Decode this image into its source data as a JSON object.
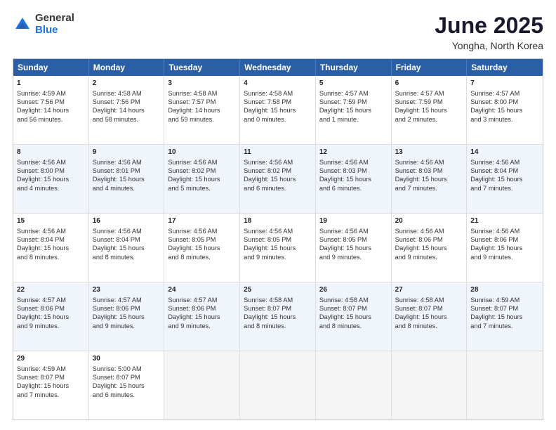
{
  "logo": {
    "general": "General",
    "blue": "Blue"
  },
  "title": "June 2025",
  "subtitle": "Yongha, North Korea",
  "header_days": [
    "Sunday",
    "Monday",
    "Tuesday",
    "Wednesday",
    "Thursday",
    "Friday",
    "Saturday"
  ],
  "weeks": [
    {
      "alt": false,
      "cells": [
        {
          "day": "1",
          "lines": [
            "Sunrise: 4:59 AM",
            "Sunset: 7:56 PM",
            "Daylight: 14 hours",
            "and 56 minutes."
          ]
        },
        {
          "day": "2",
          "lines": [
            "Sunrise: 4:58 AM",
            "Sunset: 7:56 PM",
            "Daylight: 14 hours",
            "and 58 minutes."
          ]
        },
        {
          "day": "3",
          "lines": [
            "Sunrise: 4:58 AM",
            "Sunset: 7:57 PM",
            "Daylight: 14 hours",
            "and 59 minutes."
          ]
        },
        {
          "day": "4",
          "lines": [
            "Sunrise: 4:58 AM",
            "Sunset: 7:58 PM",
            "Daylight: 15 hours",
            "and 0 minutes."
          ]
        },
        {
          "day": "5",
          "lines": [
            "Sunrise: 4:57 AM",
            "Sunset: 7:59 PM",
            "Daylight: 15 hours",
            "and 1 minute."
          ]
        },
        {
          "day": "6",
          "lines": [
            "Sunrise: 4:57 AM",
            "Sunset: 7:59 PM",
            "Daylight: 15 hours",
            "and 2 minutes."
          ]
        },
        {
          "day": "7",
          "lines": [
            "Sunrise: 4:57 AM",
            "Sunset: 8:00 PM",
            "Daylight: 15 hours",
            "and 3 minutes."
          ]
        }
      ]
    },
    {
      "alt": true,
      "cells": [
        {
          "day": "8",
          "lines": [
            "Sunrise: 4:56 AM",
            "Sunset: 8:00 PM",
            "Daylight: 15 hours",
            "and 4 minutes."
          ]
        },
        {
          "day": "9",
          "lines": [
            "Sunrise: 4:56 AM",
            "Sunset: 8:01 PM",
            "Daylight: 15 hours",
            "and 4 minutes."
          ]
        },
        {
          "day": "10",
          "lines": [
            "Sunrise: 4:56 AM",
            "Sunset: 8:02 PM",
            "Daylight: 15 hours",
            "and 5 minutes."
          ]
        },
        {
          "day": "11",
          "lines": [
            "Sunrise: 4:56 AM",
            "Sunset: 8:02 PM",
            "Daylight: 15 hours",
            "and 6 minutes."
          ]
        },
        {
          "day": "12",
          "lines": [
            "Sunrise: 4:56 AM",
            "Sunset: 8:03 PM",
            "Daylight: 15 hours",
            "and 6 minutes."
          ]
        },
        {
          "day": "13",
          "lines": [
            "Sunrise: 4:56 AM",
            "Sunset: 8:03 PM",
            "Daylight: 15 hours",
            "and 7 minutes."
          ]
        },
        {
          "day": "14",
          "lines": [
            "Sunrise: 4:56 AM",
            "Sunset: 8:04 PM",
            "Daylight: 15 hours",
            "and 7 minutes."
          ]
        }
      ]
    },
    {
      "alt": false,
      "cells": [
        {
          "day": "15",
          "lines": [
            "Sunrise: 4:56 AM",
            "Sunset: 8:04 PM",
            "Daylight: 15 hours",
            "and 8 minutes."
          ]
        },
        {
          "day": "16",
          "lines": [
            "Sunrise: 4:56 AM",
            "Sunset: 8:04 PM",
            "Daylight: 15 hours",
            "and 8 minutes."
          ]
        },
        {
          "day": "17",
          "lines": [
            "Sunrise: 4:56 AM",
            "Sunset: 8:05 PM",
            "Daylight: 15 hours",
            "and 8 minutes."
          ]
        },
        {
          "day": "18",
          "lines": [
            "Sunrise: 4:56 AM",
            "Sunset: 8:05 PM",
            "Daylight: 15 hours",
            "and 9 minutes."
          ]
        },
        {
          "day": "19",
          "lines": [
            "Sunrise: 4:56 AM",
            "Sunset: 8:05 PM",
            "Daylight: 15 hours",
            "and 9 minutes."
          ]
        },
        {
          "day": "20",
          "lines": [
            "Sunrise: 4:56 AM",
            "Sunset: 8:06 PM",
            "Daylight: 15 hours",
            "and 9 minutes."
          ]
        },
        {
          "day": "21",
          "lines": [
            "Sunrise: 4:56 AM",
            "Sunset: 8:06 PM",
            "Daylight: 15 hours",
            "and 9 minutes."
          ]
        }
      ]
    },
    {
      "alt": true,
      "cells": [
        {
          "day": "22",
          "lines": [
            "Sunrise: 4:57 AM",
            "Sunset: 8:06 PM",
            "Daylight: 15 hours",
            "and 9 minutes."
          ]
        },
        {
          "day": "23",
          "lines": [
            "Sunrise: 4:57 AM",
            "Sunset: 8:06 PM",
            "Daylight: 15 hours",
            "and 9 minutes."
          ]
        },
        {
          "day": "24",
          "lines": [
            "Sunrise: 4:57 AM",
            "Sunset: 8:06 PM",
            "Daylight: 15 hours",
            "and 9 minutes."
          ]
        },
        {
          "day": "25",
          "lines": [
            "Sunrise: 4:58 AM",
            "Sunset: 8:07 PM",
            "Daylight: 15 hours",
            "and 8 minutes."
          ]
        },
        {
          "day": "26",
          "lines": [
            "Sunrise: 4:58 AM",
            "Sunset: 8:07 PM",
            "Daylight: 15 hours",
            "and 8 minutes."
          ]
        },
        {
          "day": "27",
          "lines": [
            "Sunrise: 4:58 AM",
            "Sunset: 8:07 PM",
            "Daylight: 15 hours",
            "and 8 minutes."
          ]
        },
        {
          "day": "28",
          "lines": [
            "Sunrise: 4:59 AM",
            "Sunset: 8:07 PM",
            "Daylight: 15 hours",
            "and 7 minutes."
          ]
        }
      ]
    },
    {
      "alt": false,
      "cells": [
        {
          "day": "29",
          "lines": [
            "Sunrise: 4:59 AM",
            "Sunset: 8:07 PM",
            "Daylight: 15 hours",
            "and 7 minutes."
          ]
        },
        {
          "day": "30",
          "lines": [
            "Sunrise: 5:00 AM",
            "Sunset: 8:07 PM",
            "Daylight: 15 hours",
            "and 6 minutes."
          ]
        },
        {
          "day": "",
          "lines": []
        },
        {
          "day": "",
          "lines": []
        },
        {
          "day": "",
          "lines": []
        },
        {
          "day": "",
          "lines": []
        },
        {
          "day": "",
          "lines": []
        }
      ]
    }
  ]
}
